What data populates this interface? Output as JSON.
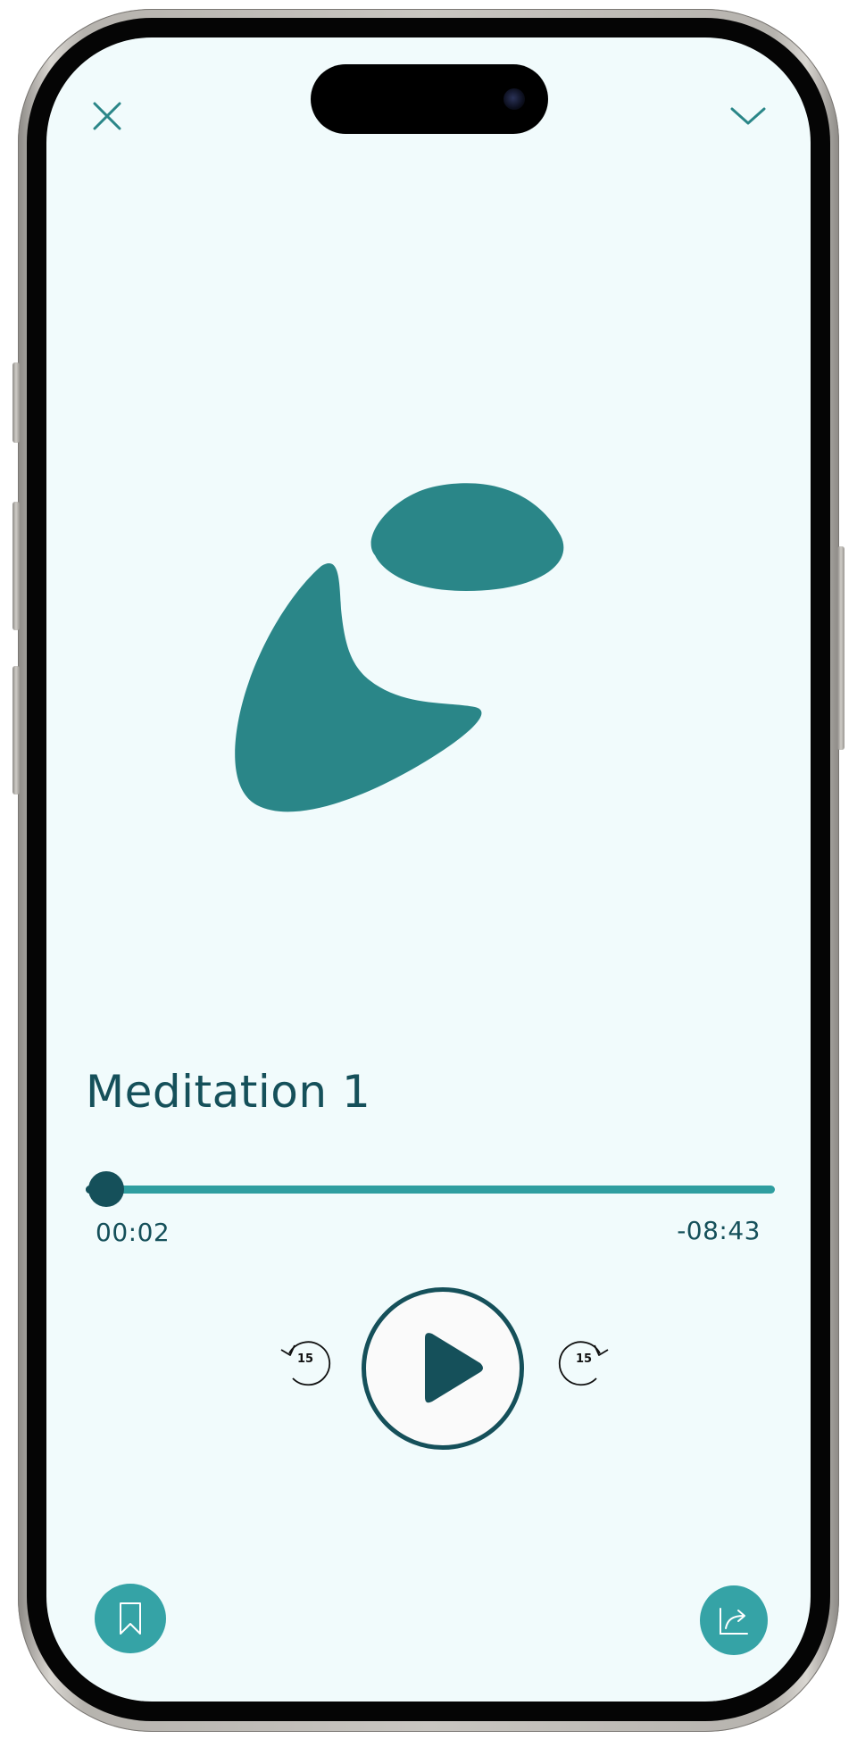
{
  "player": {
    "title": "Meditation 1",
    "elapsed": "00:02",
    "remaining": "-08:43",
    "progress_fraction": 0.004,
    "skip_back_seconds": "15",
    "skip_forward_seconds": "15"
  },
  "icons": {
    "close": "close-icon",
    "collapse": "chevron-down-icon",
    "play": "play-icon",
    "skip_back": "rewind-15-icon",
    "skip_forward": "forward-15-icon",
    "bookmark": "bookmark-icon",
    "share": "share-icon"
  },
  "colors": {
    "background": "#f1fbfc",
    "primary_dark": "#15505a",
    "primary": "#2a8688",
    "accent": "#35a3a6"
  }
}
